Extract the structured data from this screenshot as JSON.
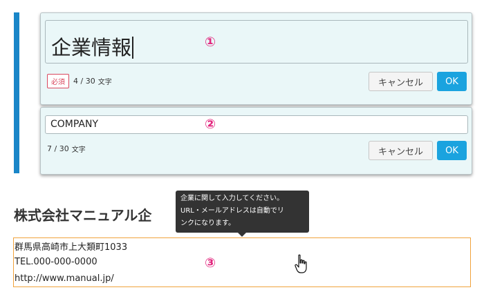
{
  "panel1": {
    "input_value": "企業情報",
    "required_badge": "必須",
    "char_count": "4 / 30",
    "char_unit": "文字",
    "cancel_label": "キャンセル",
    "ok_label": "OK"
  },
  "panel2": {
    "input_value": "COMPANY",
    "char_count": "7 / 30",
    "char_unit": "文字",
    "cancel_label": "キャンセル",
    "ok_label": "OK"
  },
  "steps": {
    "one": "①",
    "two": "②",
    "three": "③"
  },
  "company_title": "株式会社マニュアル企",
  "tooltip": {
    "line1": "企業に関して入力してください。",
    "line2": "URL・メールアドレスは自動でリ",
    "line3": "ンクになります。"
  },
  "address": {
    "line1": "群馬県高崎市上大類町1033",
    "line2": "TEL.000-000-0000",
    "line3": "http://www.manual.jp/"
  },
  "colors": {
    "accent_bar": "#1a86c8",
    "ok_button": "#1aa3df",
    "required": "#d9475d",
    "step_marker": "#e2277e",
    "hover_border": "#f0a23b"
  },
  "icons": {
    "cursor": "hand-pointer-icon"
  }
}
